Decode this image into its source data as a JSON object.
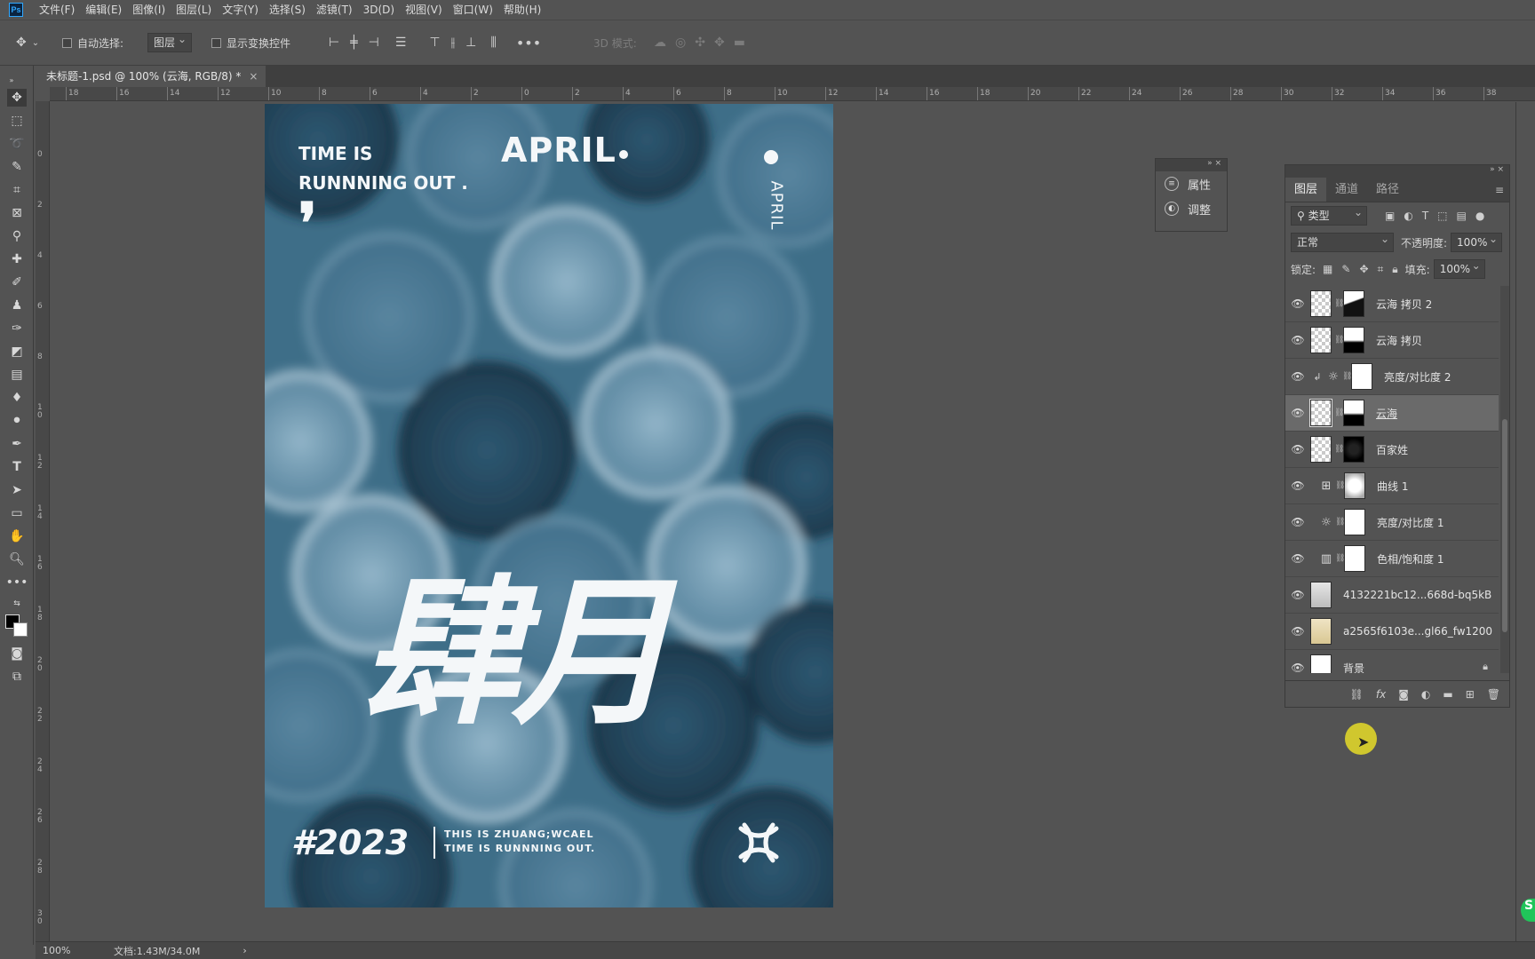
{
  "menu": [
    "文件(F)",
    "编辑(E)",
    "图像(I)",
    "图层(L)",
    "文字(Y)",
    "选择(S)",
    "滤镜(T)",
    "3D(D)",
    "视图(V)",
    "窗口(W)",
    "帮助(H)"
  ],
  "app_icon": "Ps",
  "options": {
    "auto_select_label": "自动选择:",
    "auto_select_value": "图层",
    "show_transform_label": "显示变换控件",
    "mode3d_label": "3D 模式:"
  },
  "doc_tab": {
    "title": "未标题-1.psd @ 100% (云海, RGB/8) *",
    "close": "×"
  },
  "ruler_top": [
    "18",
    "16",
    "14",
    "12",
    "10",
    "8",
    "6",
    "4",
    "2",
    "0",
    "2",
    "4",
    "6",
    "8",
    "10",
    "12",
    "14",
    "16",
    "18",
    "20",
    "22",
    "24",
    "26",
    "28",
    "30",
    "32",
    "34",
    "36",
    "38"
  ],
  "ruler_left": [
    "0",
    "2",
    "4",
    "6",
    "8",
    "10",
    "12",
    "14",
    "16",
    "18",
    "20",
    "22",
    "24",
    "26",
    "28",
    "30"
  ],
  "poster": {
    "time_line1": "TIME IS",
    "time_line2": "RUNNNING OUT .",
    "comma": "❜",
    "april_big": "APRIL",
    "april_vertical": "APRIL",
    "big_chars": "肆月",
    "year": "#2023",
    "tag_line1": "THIS IS ZHUANG;WCAEL",
    "tag_line2": "TIME IS RUNNNING OUT.",
    "colors": {
      "base": "#3e6e88",
      "light": "#8fb3c8",
      "dark": "#1f3d50"
    }
  },
  "status": {
    "zoom": "100%",
    "doc": "文档:1.43M/34.0M",
    "arrow": "›"
  },
  "props_panel": {
    "items": [
      {
        "icon": "properties-icon",
        "label": "属性"
      },
      {
        "icon": "adjustments-icon",
        "label": "调整"
      }
    ]
  },
  "layers_panel": {
    "tabs": [
      "图层",
      "通道",
      "路径"
    ],
    "filter_value": "类型",
    "blend_mode": "正常",
    "opacity_label": "不透明度:",
    "opacity_value": "100%",
    "lock_label": "锁定:",
    "fill_label": "填充:",
    "fill_value": "100%",
    "layers": [
      {
        "name": "云海 拷贝 2",
        "thumb": "checker",
        "mask": "mask-a",
        "selected": false
      },
      {
        "name": "云海 拷贝",
        "thumb": "checker",
        "mask": "mask-b",
        "selected": false
      },
      {
        "name": "亮度/对比度 2",
        "adjust": "brightness-icon",
        "mask": "white",
        "clip": true,
        "selected": false
      },
      {
        "name": "云海",
        "thumb": "checker",
        "mask": "mask-b",
        "selected": true
      },
      {
        "name": "百家姓",
        "thumb": "checker",
        "mask": "mask-c",
        "selected": false
      },
      {
        "name": "曲线 1",
        "adjust": "curves-icon",
        "mask": "mask-d",
        "selected": false
      },
      {
        "name": "亮度/对比度 1",
        "adjust": "brightness-icon",
        "mask": "white",
        "selected": false
      },
      {
        "name": "色相/饱和度 1",
        "adjust": "hue-saturation-icon",
        "mask": "white",
        "selected": false
      },
      {
        "name": "4132221bc12...668d-bq5kB",
        "thumb": "img-a",
        "selected": false
      },
      {
        "name": "a2565f6103e...gl66_fw1200",
        "thumb": "img-b",
        "selected": false
      },
      {
        "name": "背景",
        "thumb": "white",
        "locked": true,
        "selected": false
      }
    ]
  }
}
